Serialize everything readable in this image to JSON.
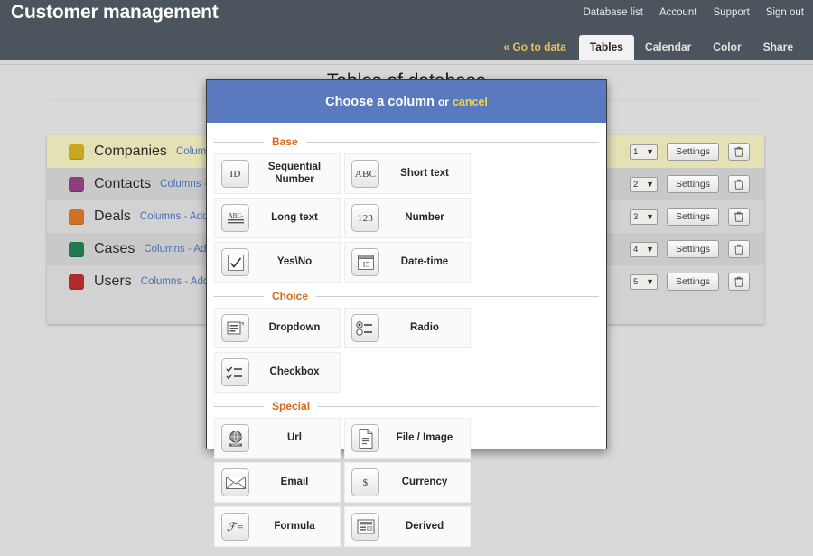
{
  "header": {
    "app_title": "Customer management",
    "nav_links": [
      {
        "label": "Database list"
      },
      {
        "label": "Account"
      },
      {
        "label": "Support"
      },
      {
        "label": "Sign out"
      }
    ],
    "tabs": [
      {
        "label": "« Go to data",
        "active": false,
        "kind": "goto"
      },
      {
        "label": "Tables",
        "active": true,
        "kind": "tab"
      },
      {
        "label": "Calendar",
        "active": false,
        "kind": "tab"
      },
      {
        "label": "Color",
        "active": false,
        "kind": "tab"
      },
      {
        "label": "Share",
        "active": false,
        "kind": "tab"
      }
    ]
  },
  "page": {
    "title": "Tables of database"
  },
  "tables": {
    "columns_link": "Columns",
    "separator": "-",
    "add_link": "Add column",
    "settings_label": "Settings",
    "trash_icon": "trash-icon",
    "rows": [
      {
        "name": "Companies",
        "color": "#c9a81e",
        "order": "1",
        "selected": true
      },
      {
        "name": "Contacts",
        "color": "#8e3d7e",
        "order": "2",
        "selected": false
      },
      {
        "name": "Deals",
        "color": "#d2702a",
        "order": "3",
        "selected": false
      },
      {
        "name": "Cases",
        "color": "#1f7a4d",
        "order": "4",
        "selected": false
      },
      {
        "name": "Users",
        "color": "#b52a2a",
        "order": "5",
        "selected": false
      }
    ]
  },
  "modal": {
    "title": "Choose a column",
    "or_text": "or",
    "cancel_label": "cancel",
    "sections": [
      {
        "label": "Base",
        "items": [
          {
            "label": "Sequential Number",
            "icon": "id-icon",
            "glyph": "ID"
          },
          {
            "label": "Short text",
            "icon": "abc-icon",
            "glyph": "ABC"
          },
          {
            "label": "Long text",
            "icon": "long-text-icon",
            "glyph": "ABC-"
          },
          {
            "label": "Number",
            "icon": "number-icon",
            "glyph": "123"
          },
          {
            "label": "Yes\\No",
            "icon": "checkmark-icon",
            "glyph": "✓"
          },
          {
            "label": "Date-time",
            "icon": "calendar-icon",
            "glyph": "15"
          }
        ]
      },
      {
        "label": "Choice",
        "items": [
          {
            "label": "Dropdown",
            "icon": "dropdown-icon",
            "glyph": ""
          },
          {
            "label": "Radio",
            "icon": "radio-icon",
            "glyph": ""
          },
          {
            "label": "Checkbox",
            "icon": "checkbox-list-icon",
            "glyph": ""
          }
        ]
      },
      {
        "label": "Special",
        "items": [
          {
            "label": "Url",
            "icon": "globe-icon",
            "glyph": ""
          },
          {
            "label": "File / Image",
            "icon": "document-icon",
            "glyph": ""
          },
          {
            "label": "Email",
            "icon": "envelope-icon",
            "glyph": ""
          },
          {
            "label": "Currency",
            "icon": "dollar-icon",
            "glyph": "$"
          },
          {
            "label": "Formula",
            "icon": "formula-icon",
            "glyph": "ℱ="
          },
          {
            "label": "Derived",
            "icon": "derived-icon",
            "glyph": ""
          }
        ]
      }
    ]
  },
  "colors": {
    "header_bg": "#4c555d",
    "modal_header_bg": "#5a7abf",
    "accent_orange": "#d2691e",
    "link_blue": "#4a6fb5",
    "selected_row": "#e4e2b4",
    "page_bg": "#d9d9d9"
  }
}
